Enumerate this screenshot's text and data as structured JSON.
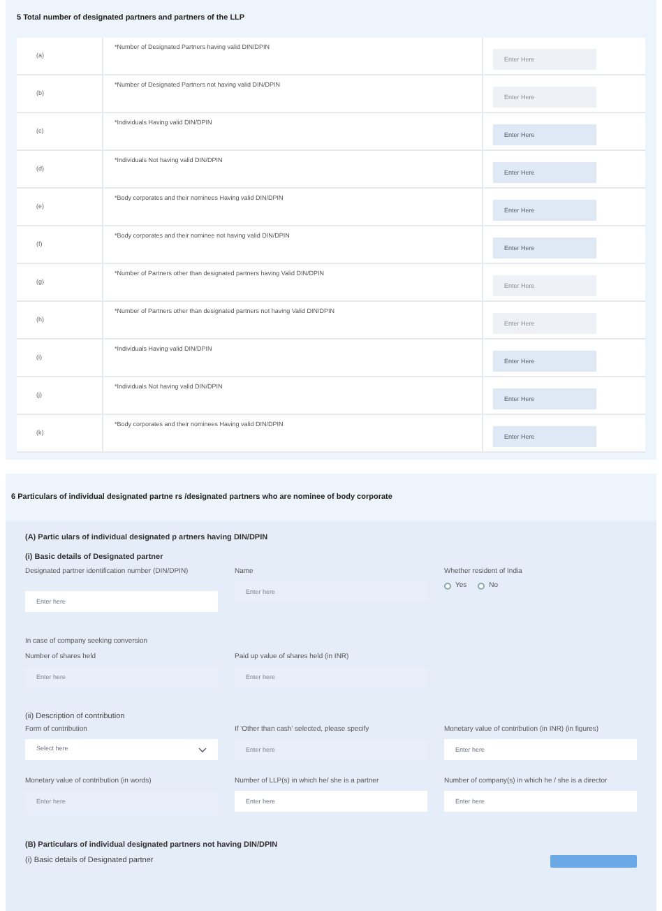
{
  "section5": {
    "title": "5 Total number of designated partners and partners of the LLP",
    "rows": [
      {
        "index": "(a)",
        "label": "*Number of Designated Partners having valid DIN/DPIN",
        "placeholder": "Enter Here",
        "disabled": true
      },
      {
        "index": "(b)",
        "label": "*Number of Designated Partners not having valid DIN/DPIN",
        "placeholder": "Enter Here",
        "disabled": true
      },
      {
        "index": "(c)",
        "label": "*Individuals Having valid DIN/DPIN",
        "placeholder": "Enter Here",
        "disabled": false
      },
      {
        "index": "(d)",
        "label": "*Individuals Not having valid DIN/DPIN",
        "placeholder": "Enter Here",
        "disabled": false
      },
      {
        "index": "(e)",
        "label": "*Body corporates and their nominees Having valid DIN/DPIN",
        "placeholder": "Enter Here",
        "disabled": false
      },
      {
        "index": "(f)",
        "label": "*Body corporates and their nominee not having valid DIN/DPIN",
        "placeholder": "Enter Here",
        "disabled": false
      },
      {
        "index": "(g)",
        "label": "*Number of Partners other than designated partners having Valid DIN/DPIN",
        "placeholder": "Enter Here",
        "disabled": true
      },
      {
        "index": "(h)",
        "label": "*Number of Partners other than designated partners not having Valid DIN/DPIN",
        "placeholder": "Enter Here",
        "disabled": true
      },
      {
        "index": "(i)",
        "label": "*Individuals Having valid DIN/DPIN",
        "placeholder": "Enter Here",
        "disabled": false
      },
      {
        "index": "(j)",
        "label": "*Individuals Not having valid DIN/DPIN",
        "placeholder": "Enter Here",
        "disabled": false
      },
      {
        "index": "(k)",
        "label": "*Body corporates and their nominees Having valid DIN/DPIN",
        "placeholder": "Enter Here",
        "disabled": false
      }
    ]
  },
  "section6": {
    "title": "6 Particulars of individual designated partne rs /designated partners who are nominee of body corporate",
    "part_a": {
      "title": "(A) Partic ulars of individual designated p artners having DIN/DPIN",
      "basic_title": "(i) Basic details of Designated partner",
      "din": {
        "label": "Designated partner identification number (DIN/DPIN)",
        "placeholder": "Enter here",
        "disabled": false
      },
      "name": {
        "label": "Name",
        "placeholder": "Enter here",
        "disabled": true
      },
      "resident": {
        "label": "Whether resident of India",
        "options": [
          {
            "label": "Yes",
            "selected": false
          },
          {
            "label": "No",
            "selected": false
          }
        ]
      },
      "conversion_title": "In case of company seeking conversion",
      "shares": {
        "label": "Number of shares held",
        "placeholder": "Enter here",
        "disabled": true
      },
      "paid_up": {
        "label": "Paid up value of shares held (in INR)",
        "placeholder": "Enter here",
        "disabled": true
      },
      "contribution_title": "(ii) Description of contribution",
      "form": {
        "label": "Form of contribution",
        "placeholder": "Select here",
        "disabled": false
      },
      "other": {
        "label": "If 'Other than cash' selected, please specify",
        "placeholder": "Enter here",
        "disabled": true
      },
      "monetary_figures": {
        "label": "Monetary value of contribution (in INR) (in figures)",
        "placeholder": "Enter here",
        "disabled": false
      },
      "monetary_words": {
        "label": "Monetary value of contribution (in words)",
        "placeholder": "Enter here",
        "disabled": true
      },
      "llp_count": {
        "label": "Number of LLP(s) in which he/ she is a partner",
        "placeholder": "Enter here",
        "disabled": false
      },
      "company_count": {
        "label": "Number of company(s) in which he / she is a director",
        "placeholder": "Enter here",
        "disabled": false
      }
    },
    "part_b": {
      "title": "(B) Particulars of individual designated partners not having DIN/DPIN",
      "basic_title": "(i) Basic details of Designated partner"
    }
  }
}
